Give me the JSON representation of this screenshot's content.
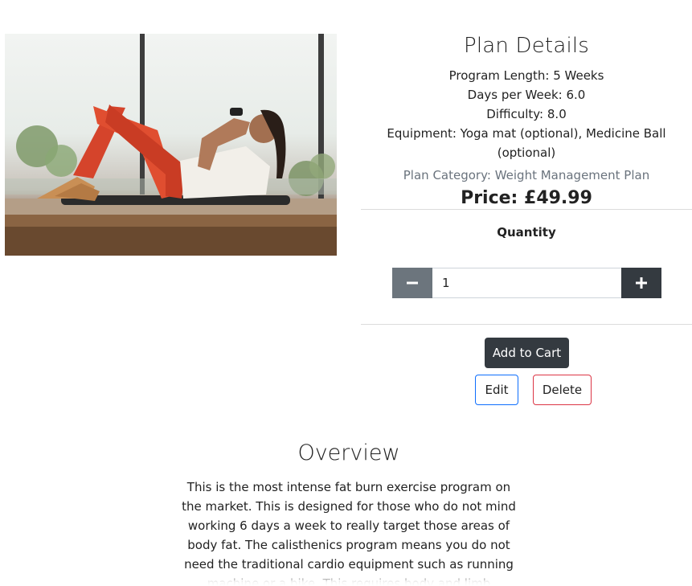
{
  "plan": {
    "image_alt": "Woman doing sit-ups on a mat",
    "title": "Plan Details",
    "program_length": "Program Length: 5 Weeks",
    "days_per_week": "Days per Week: 6.0",
    "difficulty": "Difficulty: 8.0",
    "equipment": "Equipment: Yoga mat (optional), Medicine Ball (optional)",
    "category_label": "Plan Category: ",
    "category_value": "Weight Management Plan",
    "price": "Price: £49.99"
  },
  "quantity": {
    "label": "Quantity",
    "value": "1",
    "minus_icon": "minus-icon",
    "plus_icon": "plus-icon"
  },
  "actions": {
    "add_to_cart": "Add to Cart",
    "edit": "Edit",
    "delete": "Delete"
  },
  "overview": {
    "title": "Overview",
    "text": "This is the most intense fat burn exercise program on the market. This is designed for those who do not mind working 6 days a week to really target those areas of body fat. The calisthenics program means you do not need the traditional cardio equipment such as running machine or a bike. This requires body and limb strength and lots of core exercises."
  },
  "colors": {
    "dark_button": "#343a40",
    "secondary_button": "#6c757d",
    "edit_border": "#0d6efd",
    "delete_border": "#dc3545",
    "muted_text": "#6a737d"
  }
}
